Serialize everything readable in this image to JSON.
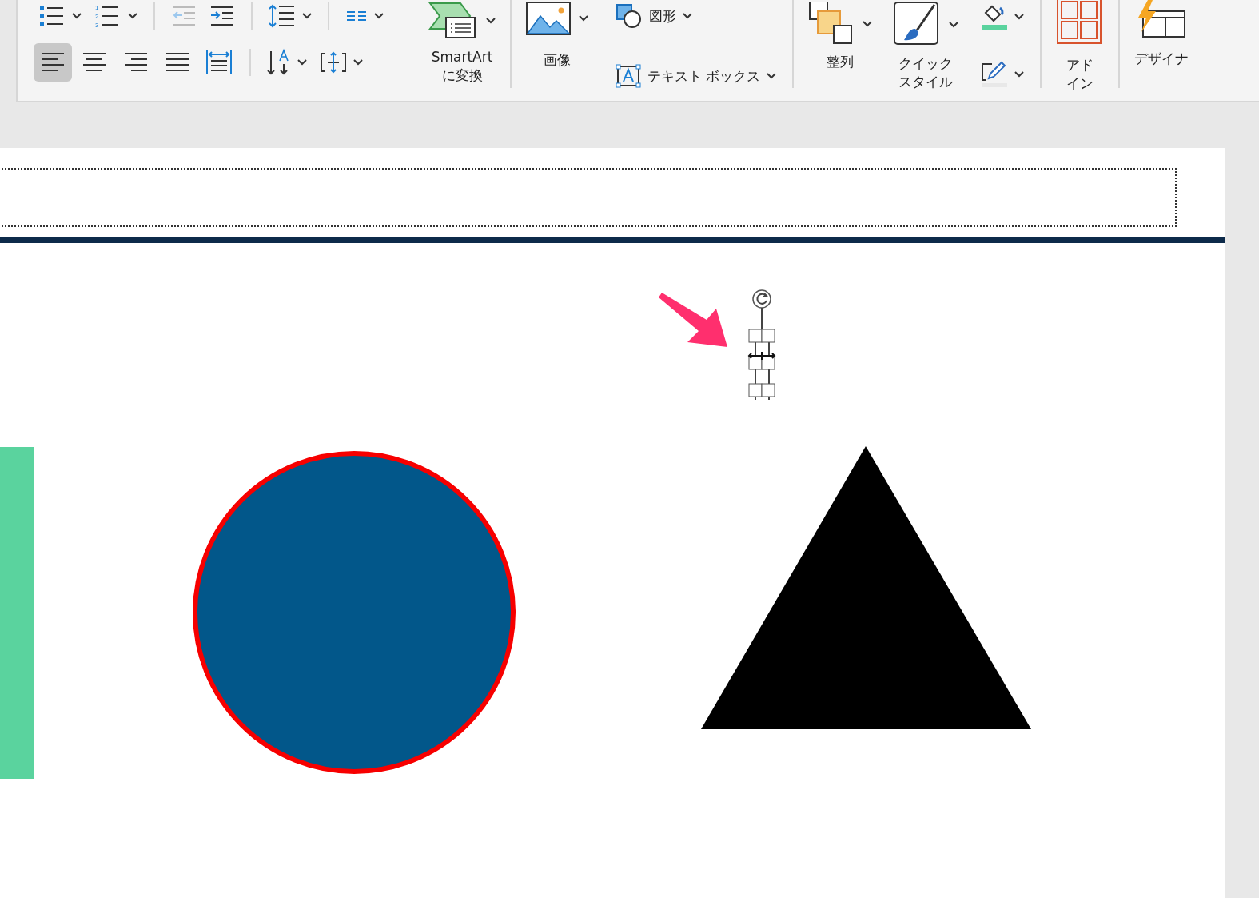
{
  "ribbon": {
    "list_controls": [
      {
        "kind": "bullets",
        "caret": true
      },
      {
        "kind": "numbering",
        "caret": true,
        "numbers": [
          "1",
          "2",
          "3"
        ]
      },
      {
        "kind": "outdent",
        "caret": false,
        "disabled": true
      },
      {
        "kind": "indent",
        "caret": false,
        "disabled": false
      },
      {
        "kind": "line_spacing",
        "caret": true
      },
      {
        "kind": "columns",
        "caret": true
      }
    ],
    "alignment": [
      {
        "kind": "left",
        "selected": true
      },
      {
        "kind": "center",
        "selected": false
      },
      {
        "kind": "right",
        "selected": false
      },
      {
        "kind": "justify",
        "selected": false
      },
      {
        "kind": "distributed",
        "selected": false
      }
    ],
    "text_controls": [
      {
        "kind": "text_direction",
        "caret": true
      },
      {
        "kind": "align_text",
        "caret": true
      }
    ],
    "smartart": "SmartArt\nに変換",
    "image": "画像",
    "shapes": "図形",
    "textbox": "テキスト ボックス",
    "arrange": "整列",
    "quick_styles": "クイックスタイル",
    "addins": "アドイン",
    "designer": "デザイナ"
  }
}
